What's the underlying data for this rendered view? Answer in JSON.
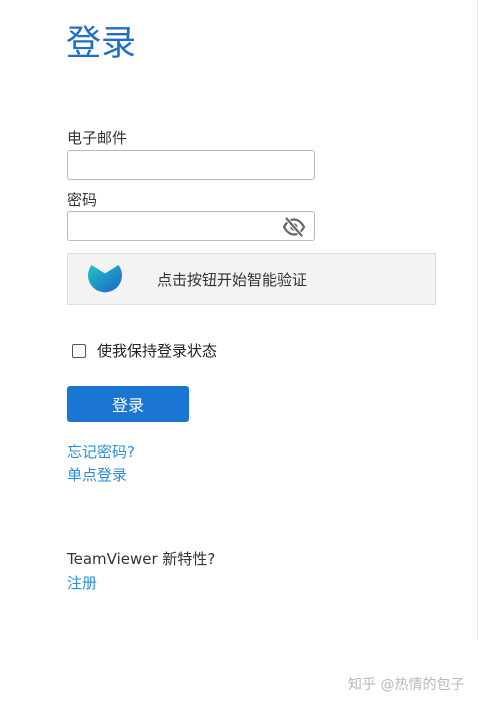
{
  "page": {
    "title": "登录"
  },
  "form": {
    "email_label": "电子邮件",
    "email_value": "",
    "password_label": "密码",
    "password_value": "",
    "captcha_text": "点击按钮开始智能验证",
    "remember_label": "使我保持登录状态",
    "remember_checked": false,
    "login_button": "登录"
  },
  "links": {
    "forgot_password": "忘记密码?",
    "sso_login": "单点登录",
    "whats_new": "TeamViewer 新特性?",
    "register": "注册"
  },
  "icons": {
    "password_toggle": "eye-off-icon",
    "captcha_logo": "smart-verify-logo-icon",
    "checkbox": "checkbox-unchecked-icon"
  },
  "colors": {
    "title": "#1f6fc5",
    "primary_button": "#1a76d2",
    "link": "#2a8fd8",
    "captcha_gradient_start": "#1db7c9",
    "captcha_gradient_end": "#1d67c8"
  },
  "watermark": "知乎 @热情的包子"
}
